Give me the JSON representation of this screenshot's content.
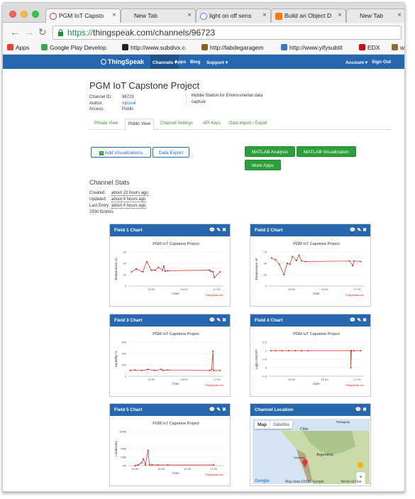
{
  "browser": {
    "tabs": [
      {
        "label": "PGM IoT Capsto",
        "active": true,
        "color": "#d32f2f"
      },
      {
        "label": "New Tab",
        "active": false,
        "color": ""
      },
      {
        "label": "light on off sens",
        "active": false,
        "color": "#4285f4"
      },
      {
        "label": "Build an Object D",
        "active": false,
        "color": "#f57c00"
      },
      {
        "label": "New Tab",
        "active": false,
        "color": ""
      }
    ],
    "url_scheme": "https://",
    "url_rest": "thingspeak.com/channels/96723",
    "bookmarks": [
      {
        "label": "Apps",
        "icon": "apps-grid-icon",
        "color": "#ea4335"
      },
      {
        "label": "Google Play Develop",
        "icon": "play-store-icon",
        "color": "#34a853"
      },
      {
        "label": "http://www.subdivx.c",
        "icon": "subdivx-icon",
        "color": "#222222"
      },
      {
        "label": "http://labdegaragem",
        "icon": "labdegaragem-icon",
        "color": "#8b5e1a"
      },
      {
        "label": "http://www.yifysubtit",
        "icon": "yify-icon",
        "color": "#3a78c9"
      },
      {
        "label": "EDX",
        "icon": "edx-icon",
        "color": "#d0021b"
      },
      {
        "label": "wo",
        "icon": "bookmark-icon",
        "color": "#8a6d3b"
      }
    ]
  },
  "ts_nav": {
    "logo": "ThingSpeak",
    "items": [
      "Channels ▾",
      "Apps",
      "Blog",
      "Support ▾"
    ],
    "right": [
      "Account ▾",
      "Sign Out"
    ]
  },
  "channel": {
    "title": "PGM IoT Capstone Project",
    "meta": [
      {
        "k": "Channel ID:",
        "v": "96723",
        "link": false
      },
      {
        "k": "Author:",
        "v": "mjroval",
        "link": true
      },
      {
        "k": "Access:",
        "v": "Public",
        "link": false
      }
    ],
    "description": "Mobile Station for Environmental data capture",
    "tabs": [
      "Private View",
      "Public View",
      "Channel Settings",
      "API Keys",
      "Data Import / Export"
    ],
    "buttons": {
      "add_viz": "Add Visualizations",
      "data_export": "Data Export",
      "matlab_analysis": "MATLAB Analysis",
      "matlab_viz": "MATLAB Visualization",
      "more_apps": "More Apps"
    },
    "stats_title": "Channel Stats",
    "stats": [
      {
        "k": "Created:",
        "v": "about 22 hours ago"
      },
      {
        "k": "Updated:",
        "v": "about 4 hours ago"
      },
      {
        "k": "Last Entry:",
        "v": "about 4 hours ago"
      }
    ],
    "entries": "2930 Entries"
  },
  "cards": [
    {
      "title": "Field 1 Chart",
      "icons": "💬 ✎ ✖"
    },
    {
      "title": "Field 2 Chart",
      "icons": "💬 ✎ ✖"
    },
    {
      "title": "Field 3 Chart",
      "icons": "💬 ✎ ✖"
    },
    {
      "title": "Field 4 Chart",
      "icons": "💬 ✎ ✖"
    },
    {
      "title": "Field 5 Chart",
      "icons": "💬 ✎ ✖"
    },
    {
      "title": "Channel Location",
      "icons": "💬 ✖"
    }
  ],
  "map": {
    "type_buttons": [
      "Map",
      "Satellite"
    ],
    "labels": [
      "Chile",
      "Argentina",
      "Santiago",
      "Paraguay"
    ],
    "google": "Google",
    "attribution": "Map data ©2016 Google",
    "terms": "Terms of Use"
  },
  "chart_data": [
    {
      "type": "line",
      "title": "PGM IoT Capstone Project",
      "xlabel": "Date",
      "ylabel": "Temperature oC",
      "x_ticks": [
        "15:00",
        "16:00",
        "17:00"
      ],
      "y_ticks": [
        0,
        20,
        40,
        60
      ],
      "ylim": [
        0,
        60
      ],
      "x": [
        0.5,
        1.2,
        2.2,
        2.8,
        3.5,
        4.1,
        4.6,
        5.2,
        5.4,
        5.6,
        6.0,
        12.4,
        12.6,
        12.9,
        13.1,
        14.0
      ],
      "y": [
        25,
        30,
        25,
        43,
        28,
        28,
        33,
        28,
        35,
        26,
        27,
        28,
        26,
        25,
        15,
        25
      ],
      "credit": "ThingSpeak.com",
      "color": "#d62020"
    },
    {
      "type": "line",
      "title": "PGM IoT Capstone Project",
      "xlabel": "Date",
      "ylabel": "Temperature oF",
      "x_ticks": [
        "15:00",
        "16:00",
        "17:00"
      ],
      "y_ticks": [
        0,
        25,
        50,
        75
      ],
      "ylim": [
        0,
        75
      ],
      "x": [
        0.4,
        1.0,
        1.6,
        2.3,
        2.8,
        3.2,
        3.6,
        4.2,
        4.6,
        5.0,
        5.6,
        12.3,
        12.8,
        13.0,
        14.0
      ],
      "y": [
        62,
        58,
        48,
        25,
        50,
        48,
        65,
        56,
        68,
        55,
        54,
        55,
        45,
        55,
        54
      ],
      "credit": "ThingSpeak.com",
      "color": "#d62020"
    },
    {
      "type": "line",
      "title": "PGM IoT Capstone Project",
      "xlabel": "Date",
      "ylabel": "Humidity %",
      "x_ticks": [
        "15:00",
        "16:00",
        "17:00"
      ],
      "y_ticks": [
        0,
        100,
        200,
        300
      ],
      "ylim": [
        0,
        300
      ],
      "x": [
        0.3,
        1.0,
        2.0,
        3.0,
        4.0,
        5.0,
        5.3,
        6.0,
        12.4,
        12.7,
        12.9,
        13.0,
        14.0
      ],
      "y": [
        50,
        55,
        50,
        60,
        50,
        60,
        50,
        55,
        50,
        60,
        220,
        50,
        50
      ],
      "credit": "ThingSpeak.com",
      "color": "#d62020"
    },
    {
      "type": "line",
      "title": "PGM IoT Capstone Project",
      "xlabel": "Date",
      "ylabel": "Light ON/OFF",
      "x_ticks": [
        "15:00",
        "16:00",
        "17:00"
      ],
      "y_ticks": [
        -0.5,
        0,
        0.5,
        1,
        1.5
      ],
      "ylim": [
        -0.5,
        1.5
      ],
      "x": [
        0.3,
        1.0,
        2.0,
        3.0,
        4.0,
        5.0,
        6.0,
        12.5,
        12.5,
        12.6,
        13.0,
        14.0
      ],
      "y": [
        1,
        1,
        1,
        1,
        1,
        1,
        1,
        1,
        0,
        1,
        1,
        1
      ],
      "credit": "ThingSpeak.com",
      "color": "#d62020"
    },
    {
      "type": "line",
      "title": "PGM IoT Capstone Project",
      "xlabel": "Date",
      "ylabel": "Luminosity",
      "x_ticks": [
        "14:00",
        "15:00",
        "16:00",
        "17:00"
      ],
      "y_ticks": [
        "0M",
        "25M",
        "50M",
        "100M"
      ],
      "ylim": [
        0,
        100
      ],
      "x": [
        1.0,
        1.5,
        2.0,
        2.3,
        2.6,
        3.0,
        3.2,
        3.6,
        4.5,
        6.0,
        13.0
      ],
      "y": [
        0,
        2,
        8,
        20,
        2,
        45,
        2,
        2,
        2,
        2,
        2
      ],
      "credit": "ThingSpeak.com",
      "color": "#d62020"
    }
  ]
}
